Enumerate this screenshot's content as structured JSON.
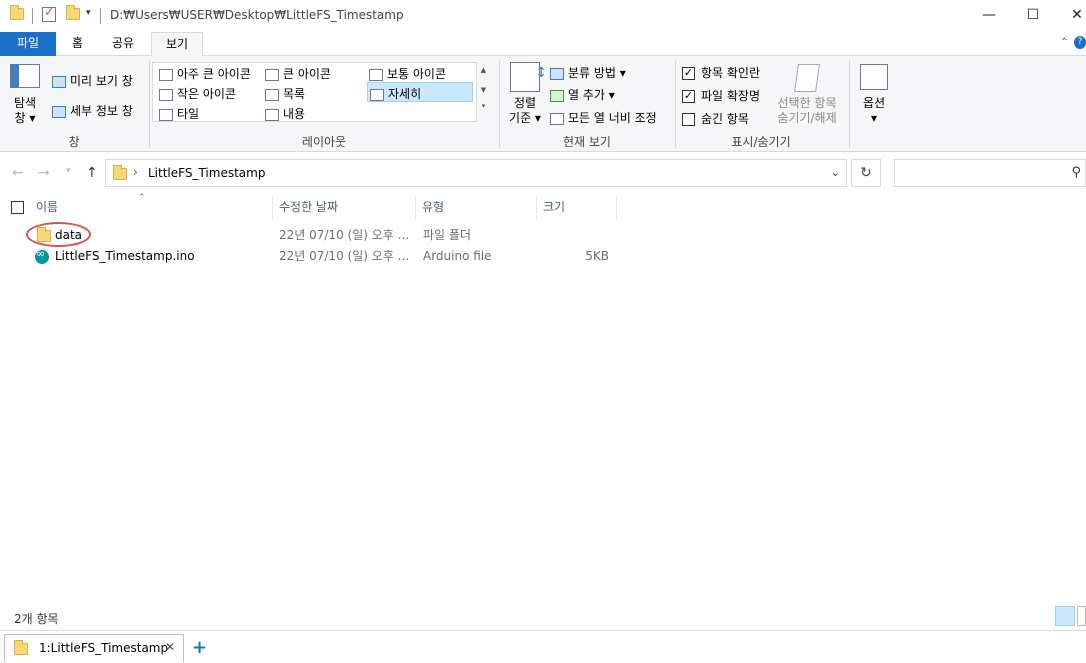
{
  "titlebar": {
    "path": "D:₩Users₩USER₩Desktop₩LittleFS_Timestamp",
    "minimize": "—",
    "maximize": "☐",
    "close": "✕"
  },
  "tabs": {
    "file": "파일",
    "home": "홈",
    "share": "공유",
    "view": "보기"
  },
  "ribbon": {
    "pane_group": {
      "nav_pane_line1": "탐색",
      "nav_pane_line2": "창 ▾",
      "preview_pane": "미리 보기 창",
      "details_pane": "세부 정보 창",
      "label": "창"
    },
    "layout_group": {
      "extra_large_icons": "아주 큰 아이콘",
      "large_icons": "큰 아이콘",
      "medium_icons": "보통 아이콘",
      "small_icons": "작은 아이콘",
      "list": "목록",
      "details": "자세히",
      "tiles": "타일",
      "content": "내용",
      "label": "레이아웃"
    },
    "current_view_group": {
      "sort_line1": "정렬",
      "sort_line2": "기준 ▾",
      "group_by": "분류 방법 ▾",
      "add_columns": "열 추가 ▾",
      "size_all_columns": "모든 열 너비 조정",
      "label": "현재 보기"
    },
    "show_hide_group": {
      "item_checkboxes": "항목 확인란",
      "file_extensions": "파일 확장명",
      "hidden_items": "숨긴 항목",
      "hide_selected_line1": "선택한 항목",
      "hide_selected_line2": "숨기기/해제",
      "label": "표시/숨기기"
    },
    "options_group": {
      "options": "옵션",
      "options_arrow": "▾"
    }
  },
  "address": {
    "current_folder": "LittleFS_Timestamp",
    "separator": "›"
  },
  "columns": {
    "name": "이름",
    "modified": "수정한 날짜",
    "type": "유형",
    "size": "크기"
  },
  "files": [
    {
      "name": "data",
      "modified": "22년 07/10 (일) 오후 ...",
      "type": "파일 폴더",
      "size": ""
    },
    {
      "name": "LittleFS_Timestamp.ino",
      "modified": "22년 07/10 (일) 오후 ...",
      "type": "Arduino file",
      "size": "5KB"
    }
  ],
  "status": {
    "item_count": "2개 항목"
  },
  "bottom_tab": {
    "label": "1:LittleFS_Timestamp",
    "close": "✕",
    "add": "+"
  },
  "colors": {
    "accent": "#1a6fc6",
    "highlight_oval": "#d9534f",
    "selection": "#cce8ff"
  }
}
